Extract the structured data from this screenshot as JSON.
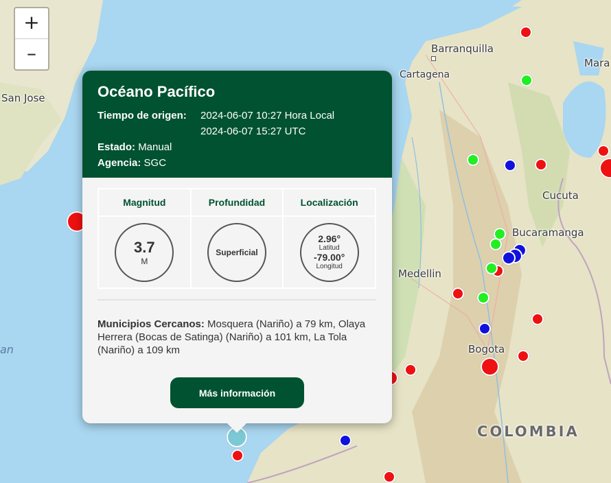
{
  "map": {
    "cities": [
      "Barranquilla",
      "Cartagena",
      "Mara",
      "San Jose",
      "Cucuta",
      "Bucaramanga",
      "Medellin",
      "Bogota",
      "COLOMBIA",
      "an"
    ],
    "zoom_in_label": "+",
    "zoom_out_label": "–"
  },
  "popup": {
    "title": "Océano Pacífico",
    "origin_time_label": "Tiempo de origen:",
    "origin_time_local": "2024-06-07 10:27 Hora Local",
    "origin_time_utc": "2024-06-07 15:27 UTC",
    "status_label": "Estado:",
    "status_value": "Manual",
    "agency_label": "Agencia:",
    "agency_value": "SGC",
    "headers": {
      "magnitude": "Magnitud",
      "depth": "Profundidad",
      "location": "Localización"
    },
    "magnitude_value": "3.7",
    "magnitude_unit": "M",
    "depth_value": "Superficial",
    "latitude_value": "2.96°",
    "latitude_label": "Latitud",
    "longitude_value": "-79.00°",
    "longitude_label": "Longitud",
    "nearby_label": "Municipios Cercanos:",
    "nearby_text": "Mosquera (Nariño) a 79 km, Olaya Herrera (Bocas de Satinga) (Nariño) a 101 km, La Tola (Nariño) a 109 km",
    "more_info_label": "Más información"
  },
  "colors": {
    "header_green": "#005230",
    "quake_red": "#ee1111",
    "quake_green": "#22ee22",
    "quake_blue": "#1111dd",
    "selected_cyan": "#7cc9d6"
  }
}
